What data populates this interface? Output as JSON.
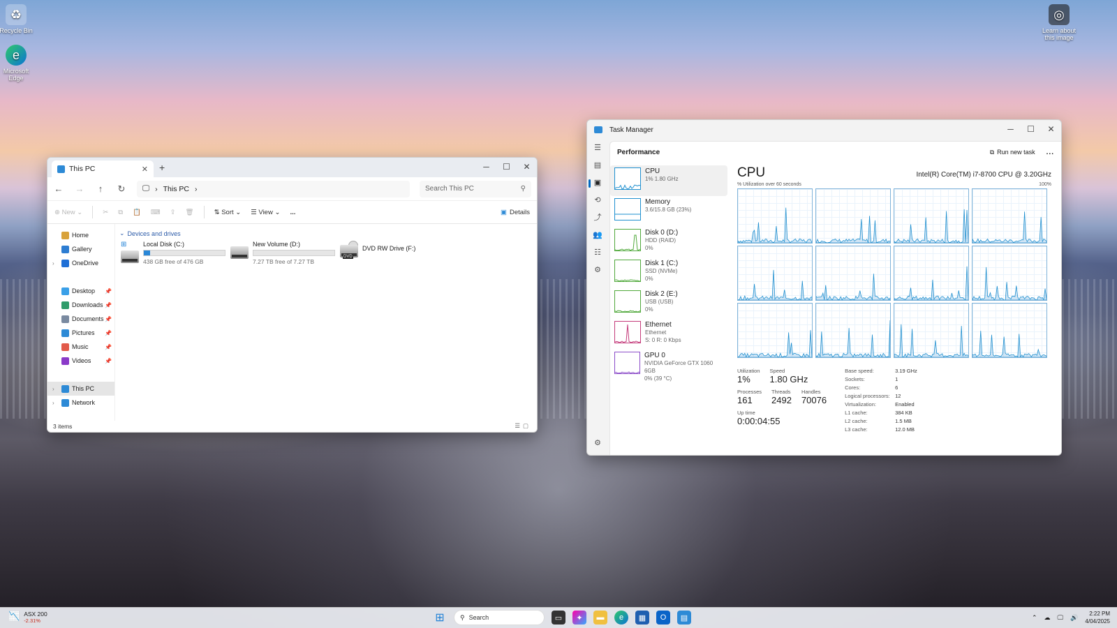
{
  "desktop": {
    "icons": [
      {
        "label": "Recycle Bin"
      },
      {
        "label": "Microsoft Edge"
      },
      {
        "label": "Learn about this image"
      }
    ]
  },
  "explorer": {
    "tab_title": "This PC",
    "breadcrumb": "This PC",
    "search_placeholder": "Search This PC",
    "cmd": {
      "new": "New",
      "sort": "Sort",
      "view": "View",
      "details": "Details",
      "more": "..."
    },
    "sidebar": {
      "top": [
        {
          "label": "Home",
          "color": "#d8a23a"
        },
        {
          "label": "Gallery",
          "color": "#2d7dd2"
        },
        {
          "label": "OneDrive",
          "color": "#1f6fd6"
        }
      ],
      "quick": [
        {
          "label": "Desktop",
          "color": "#3aa0e8"
        },
        {
          "label": "Downloads",
          "color": "#2e9c6a"
        },
        {
          "label": "Documents",
          "color": "#7a8aa0"
        },
        {
          "label": "Pictures",
          "color": "#2d8ad6"
        },
        {
          "label": "Music",
          "color": "#e25a4a"
        },
        {
          "label": "Videos",
          "color": "#8a3ac8"
        }
      ],
      "bottom": [
        {
          "label": "This PC",
          "color": "#2d8ad6"
        },
        {
          "label": "Network",
          "color": "#2d8ad6"
        }
      ]
    },
    "group": "Devices and drives",
    "drives": [
      {
        "name": "Local Disk (C:)",
        "free": "438 GB free of 476 GB",
        "used_pct": 8
      },
      {
        "name": "New Volume (D:)",
        "free": "7.27 TB free of 7.27 TB",
        "used_pct": 0
      },
      {
        "name": "DVD RW Drive (F:)",
        "badge": "DVD"
      }
    ],
    "status": "3 items"
  },
  "taskmgr": {
    "title": "Task Manager",
    "page": "Performance",
    "run_new_task": "Run new task",
    "more": "...",
    "list": [
      {
        "name": "CPU",
        "sub1": "1% 1.80 GHz",
        "sub2": "",
        "color": "#1e8fcf"
      },
      {
        "name": "Memory",
        "sub1": "3.6/15.8 GB (23%)",
        "sub2": "",
        "color": "#1e8fcf"
      },
      {
        "name": "Disk 0 (D:)",
        "sub1": "HDD (RAID)",
        "sub2": "0%",
        "color": "#4fa83a"
      },
      {
        "name": "Disk 1 (C:)",
        "sub1": "SSD (NVMe)",
        "sub2": "0%",
        "color": "#4fa83a"
      },
      {
        "name": "Disk 2 (E:)",
        "sub1": "USB (USB)",
        "sub2": "0%",
        "color": "#4fa83a"
      },
      {
        "name": "Ethernet",
        "sub1": "Ethernet",
        "sub2": "S: 0 R: 0 Kbps",
        "color": "#c43a7a"
      },
      {
        "name": "GPU 0",
        "sub1": "NVIDIA GeForce GTX 1060 6GB",
        "sub2": "0% (39 °C)",
        "color": "#8a4ac8"
      }
    ],
    "cpu": {
      "heading": "CPU",
      "model": "Intel(R) Core(TM) i7-8700 CPU @ 3.20GHz",
      "util_label": "% Utilization over 60 seconds",
      "max_label": "100%",
      "stats": {
        "utilization_label": "Utilization",
        "utilization": "1%",
        "speed_label": "Speed",
        "speed": "1.80 GHz",
        "processes_label": "Processes",
        "processes": "161",
        "threads_label": "Threads",
        "threads": "2492",
        "handles_label": "Handles",
        "handles": "70076",
        "uptime_label": "Up time",
        "uptime": "0:00:04:55"
      },
      "specs": [
        {
          "k": "Base speed:",
          "v": "3.19 GHz"
        },
        {
          "k": "Sockets:",
          "v": "1"
        },
        {
          "k": "Cores:",
          "v": "6"
        },
        {
          "k": "Logical processors:",
          "v": "12"
        },
        {
          "k": "Virtualization:",
          "v": "Enabled"
        },
        {
          "k": "L1 cache:",
          "v": "384 KB"
        },
        {
          "k": "L2 cache:",
          "v": "1.5 MB"
        },
        {
          "k": "L3 cache:",
          "v": "12.0 MB"
        }
      ]
    }
  },
  "taskbar": {
    "weather_title": "ASX 200",
    "weather_value": "-2.31%",
    "search": "Search",
    "time": "2:22 PM",
    "date": "4/04/2025"
  }
}
